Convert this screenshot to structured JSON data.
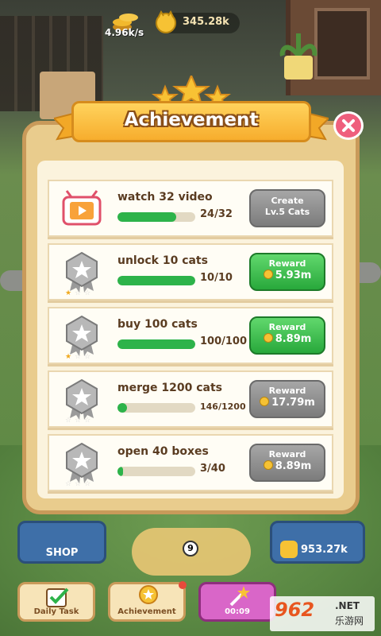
{
  "topbar": {
    "rate": "4.96k/s",
    "total": "345.28k"
  },
  "dialog": {
    "title": "Achievement",
    "close_icon": "close-icon"
  },
  "achievements": [
    {
      "title": "watch 32 video",
      "progress_text": "24/32",
      "progress": 0.75,
      "icon": "video-icon",
      "button_type": "create",
      "button_line1": "Create",
      "button_line2": "Lv.5 Cats",
      "stars": 0
    },
    {
      "title": "unlock 10 cats",
      "progress_text": "10/10",
      "progress": 1.0,
      "icon": "silver-medal-icon",
      "button_type": "reward-ready",
      "button_label": "Reward",
      "reward": "5.93m",
      "stars": 1
    },
    {
      "title": "buy 100 cats",
      "progress_text": "100/100",
      "progress": 1.0,
      "icon": "silver-medal-icon",
      "button_type": "reward-ready",
      "button_label": "Reward",
      "reward": "8.89m",
      "stars": 1
    },
    {
      "title": "merge 1200 cats",
      "progress_text": "146/1200",
      "progress": 0.12,
      "icon": "silver-medal-icon",
      "button_type": "reward-locked",
      "button_label": "Reward",
      "reward": "17.79m",
      "stars": 0
    },
    {
      "title": "open 40 boxes",
      "progress_text": "3/40",
      "progress": 0.075,
      "icon": "silver-medal-icon",
      "button_type": "reward-locked",
      "button_label": "Reward",
      "reward": "8.89m",
      "stars": 0
    }
  ],
  "bottom": {
    "shop_label": "SHOP",
    "money": "953.27k",
    "level": "9",
    "dock": [
      {
        "label": "Daily Task"
      },
      {
        "label": "Achievement"
      },
      {
        "label": "00:09"
      }
    ]
  },
  "watermark": {
    "logo": "962",
    "net": ".NET",
    "cn": "乐游网"
  },
  "colors": {
    "progress_green": "#2db34a",
    "reward_green": "#28a83b",
    "reward_grey": "#7c7c7c",
    "banner": "#f7ad2d",
    "close": "#ef5f7d"
  }
}
